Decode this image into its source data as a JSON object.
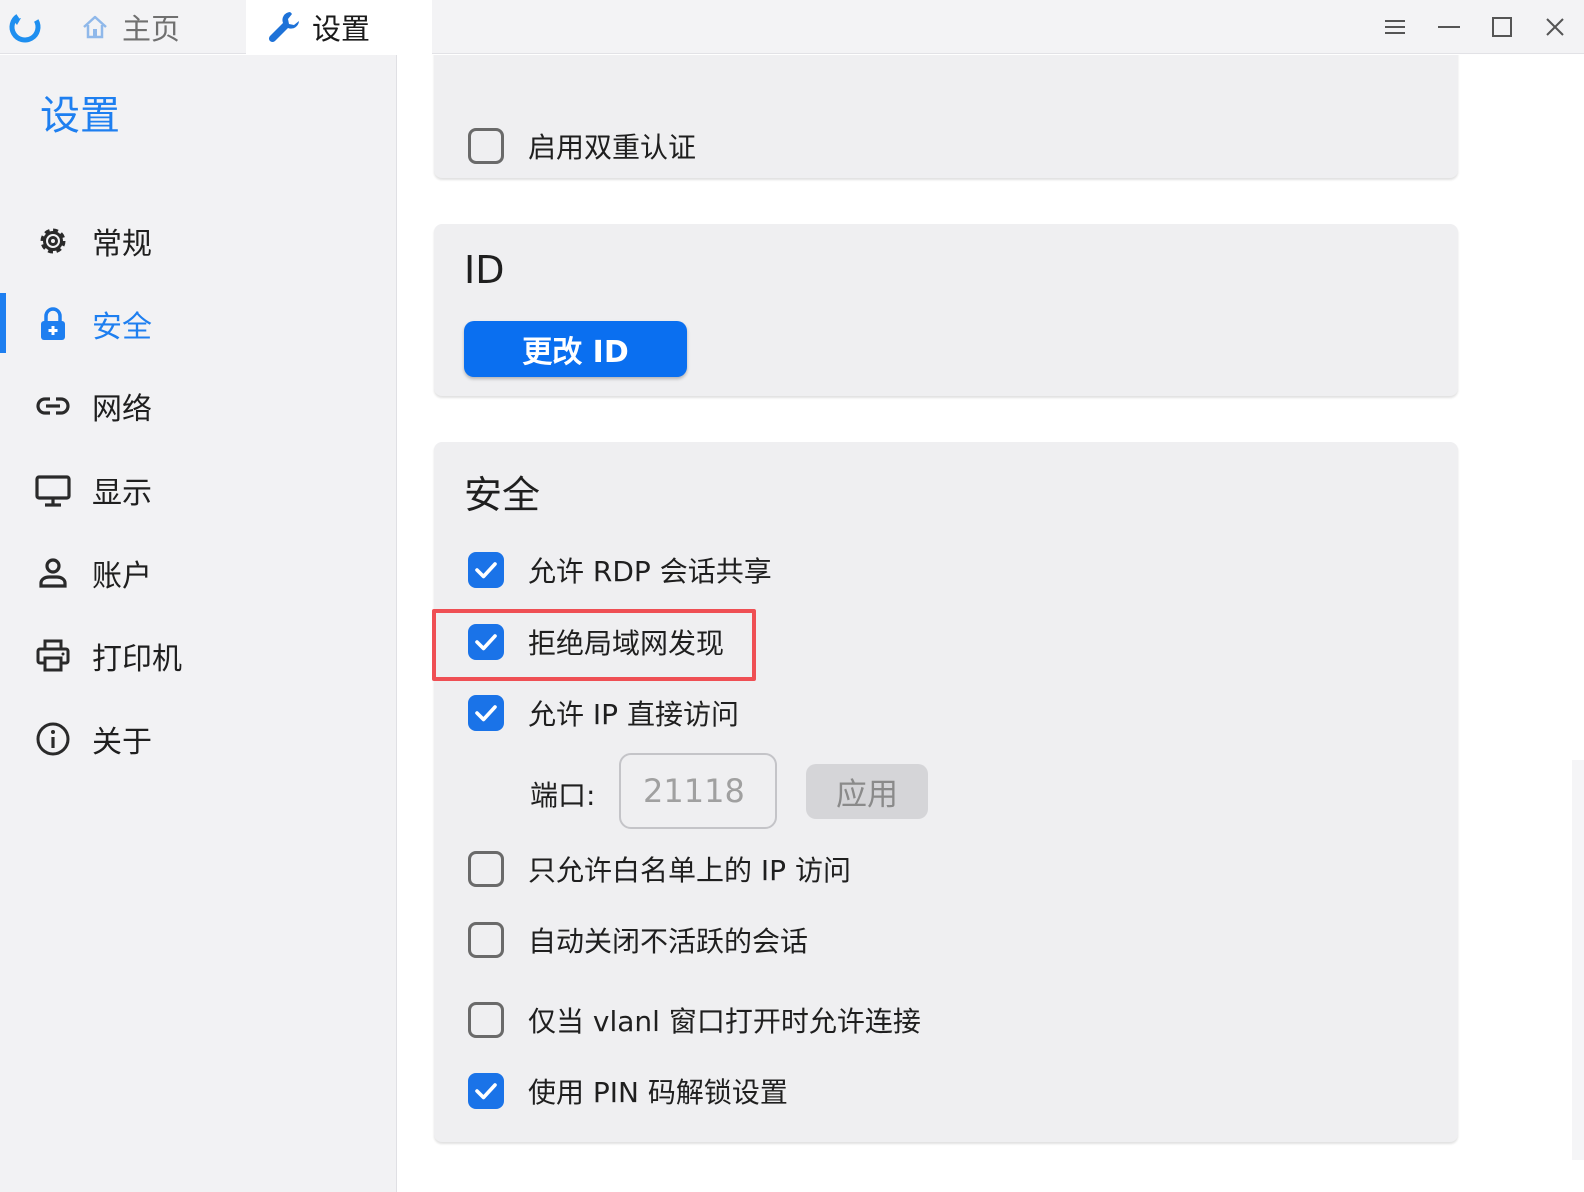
{
  "titlebar": {
    "tabs": [
      {
        "label": "主页",
        "icon": "home-icon",
        "active": false
      },
      {
        "label": "设置",
        "icon": "wrench-icon",
        "active": true
      }
    ],
    "window_controls": [
      "menu-icon",
      "minimize-icon",
      "maximize-icon",
      "close-icon"
    ]
  },
  "sidebar": {
    "title": "设置",
    "items": [
      {
        "label": "常规",
        "icon": "gear-icon",
        "active": false
      },
      {
        "label": "安全",
        "icon": "lock-icon",
        "active": true
      },
      {
        "label": "网络",
        "icon": "link-icon",
        "active": false
      },
      {
        "label": "显示",
        "icon": "monitor-icon",
        "active": false
      },
      {
        "label": "账户",
        "icon": "user-icon",
        "active": false
      },
      {
        "label": "打印机",
        "icon": "printer-icon",
        "active": false
      },
      {
        "label": "关于",
        "icon": "info-icon",
        "active": false
      }
    ]
  },
  "top_card": {
    "two_factor": {
      "label": "启用双重认证",
      "checked": false
    }
  },
  "id_card": {
    "title": "ID",
    "change_button": "更改 ID"
  },
  "security_card": {
    "title": "安全",
    "options": [
      {
        "label": "允许 RDP 会话共享",
        "checked": true
      },
      {
        "label": "拒绝局域网发现",
        "checked": true,
        "highlighted": true
      },
      {
        "label": "允许 IP 直接访问",
        "checked": true
      },
      {
        "label": "只允许白名单上的 IP 访问",
        "checked": false
      },
      {
        "label": "自动关闭不活跃的会话",
        "checked": false
      },
      {
        "label": "仅当 vlanl 窗口打开时允许连接",
        "checked": false
      },
      {
        "label": "使用 PIN 码解锁设置",
        "checked": true
      }
    ],
    "port": {
      "label": "端口:",
      "placeholder": "21118",
      "apply_button": "应用"
    }
  },
  "colors": {
    "accent": "#1e7ff0",
    "checkbox_checked": "#1a73e8",
    "highlight": "#ef4f54"
  }
}
